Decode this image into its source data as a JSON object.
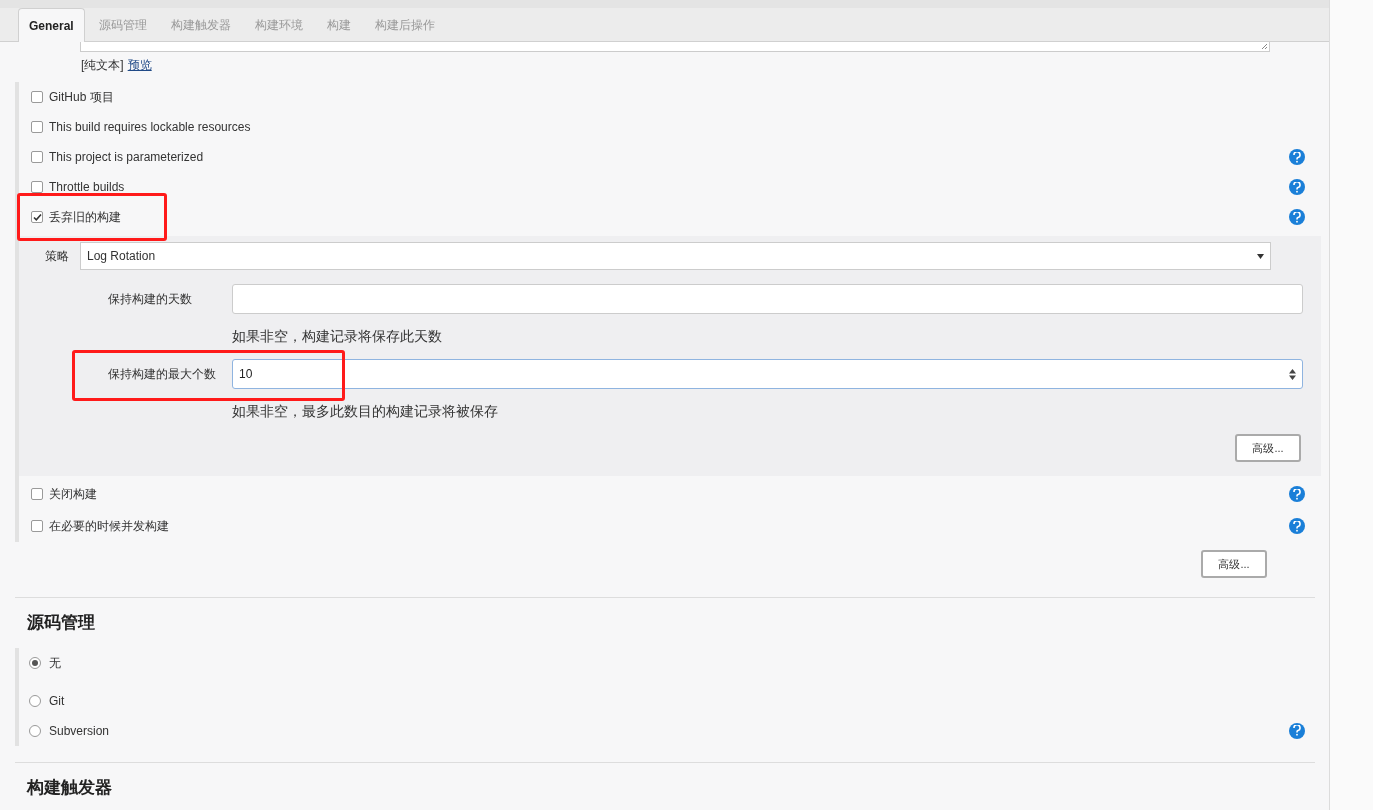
{
  "tabs": [
    {
      "label": "General",
      "selected": true
    },
    {
      "label": "源码管理",
      "selected": false
    },
    {
      "label": "构建触发器",
      "selected": false
    },
    {
      "label": "构建环境",
      "selected": false
    },
    {
      "label": "构建",
      "selected": false
    },
    {
      "label": "构建后操作",
      "selected": false
    }
  ],
  "description_editor": {
    "format_label": "[纯文本]",
    "preview_link": "预览"
  },
  "options": [
    {
      "label": "GitHub 项目",
      "checked": false,
      "help": false,
      "highlighted": false
    },
    {
      "label": "This build requires lockable resources",
      "checked": false,
      "help": false,
      "highlighted": false
    },
    {
      "label": "This project is parameterized",
      "checked": false,
      "help": true,
      "highlighted": false
    },
    {
      "label": "Throttle builds",
      "checked": false,
      "help": true,
      "highlighted": false
    },
    {
      "label": "丢弃旧的构建",
      "checked": true,
      "help": true,
      "highlighted": true,
      "details": {
        "strategy_label": "策略",
        "strategy_value": "Log Rotation",
        "fields": [
          {
            "kind": "text",
            "label": "保持构建的天数",
            "hint": "如果非空，构建记录将保存此天数",
            "highlighted": false
          },
          {
            "kind": "number",
            "label": "保持构建的最大个数",
            "value": "10",
            "hint": "如果非空，最多此数目的构建记录将被保存",
            "highlighted": true
          }
        ],
        "advanced_button": "高级..."
      }
    }
  ],
  "more_options": [
    {
      "label": "关闭构建",
      "checked": false,
      "help": true
    },
    {
      "label": "在必要的时候并发构建",
      "checked": false,
      "help": true
    }
  ],
  "advanced_button": "高级...",
  "source_code_management": {
    "heading": "源码管理",
    "choices": [
      {
        "label": "无",
        "selected": true,
        "help": false
      },
      {
        "label": "Git",
        "selected": false,
        "help": false
      },
      {
        "label": "Subversion",
        "selected": false,
        "help": true
      }
    ]
  },
  "build_triggers": {
    "heading": "构建触发器"
  }
}
